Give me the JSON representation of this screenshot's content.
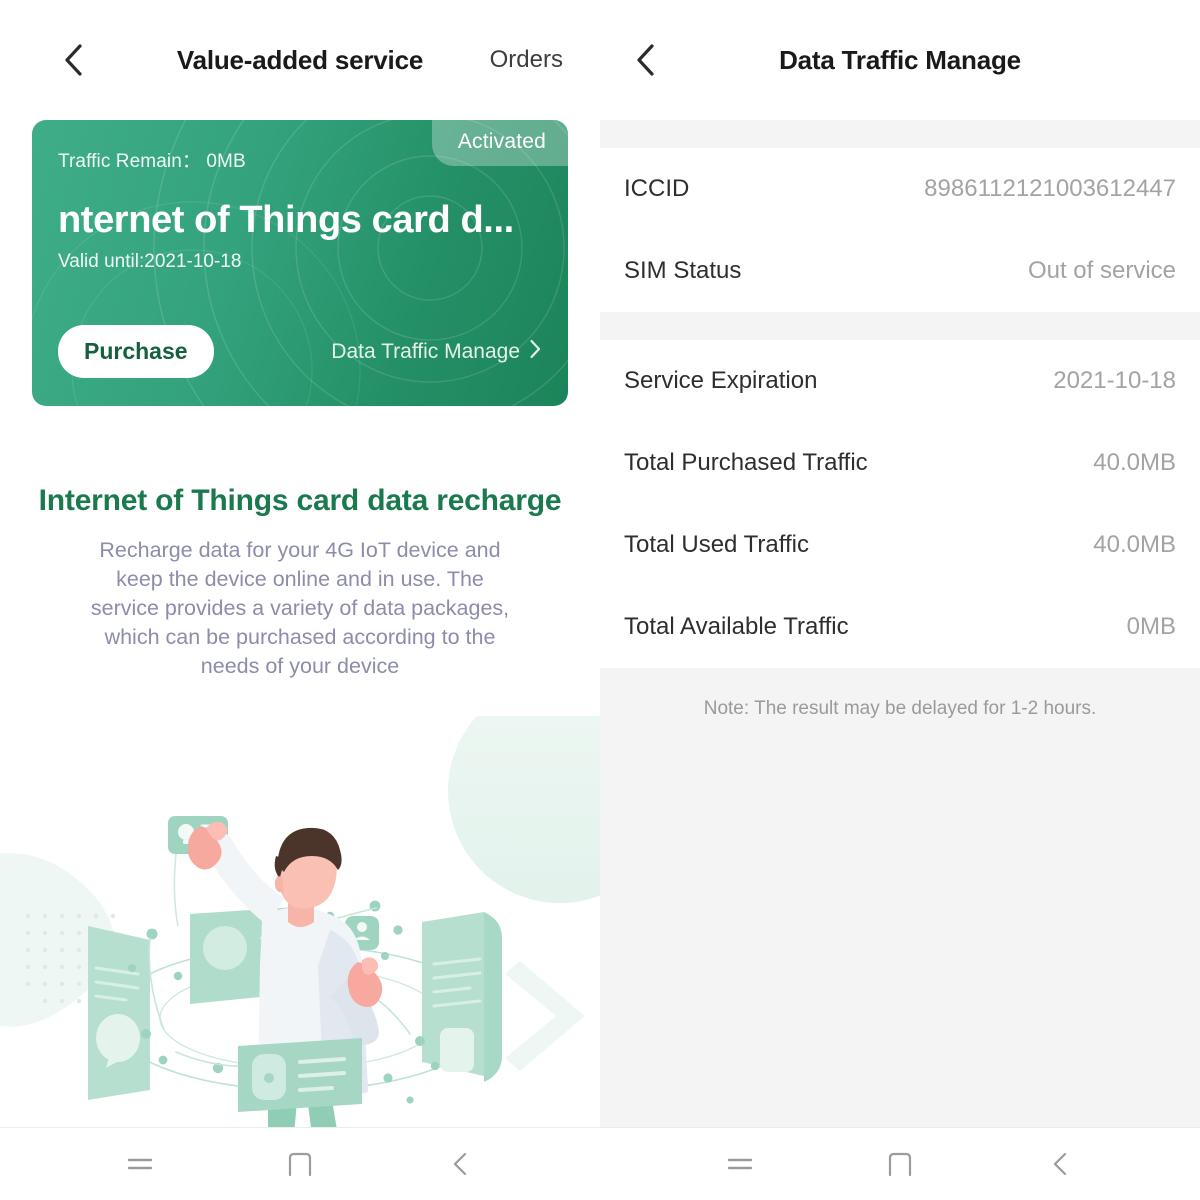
{
  "left_screen": {
    "header": {
      "back_icon": "back-chevron-icon",
      "title": "Value-added service",
      "action_label": "Orders"
    },
    "promo_card": {
      "badge": "Activated",
      "traffic_remain": "Traffic Remain： 0MB",
      "title": "nternet of Things card d...",
      "valid_until": "Valid until:2021-10-18",
      "purchase_label": "Purchase",
      "manage_label": "Data Traffic Manage",
      "manage_chevron_icon": "chevron-right-icon",
      "gradient_from": "#3fae88",
      "gradient_to": "#1c8459"
    },
    "section": {
      "heading": "Internet of Things card data recharge",
      "heading_color": "#1b7a4d",
      "description": "Recharge data for your 4G IoT device and keep the device online and in use. The service provides a variety of data packages, which can be purchased according to the needs of your device",
      "description_color": "#8c8cab"
    },
    "illustration": {
      "name": "iot-person-illustration",
      "accent": "#a8dcc8"
    }
  },
  "right_screen": {
    "header": {
      "back_icon": "back-chevron-icon",
      "title": "Data Traffic Manage"
    },
    "rows_group_1": [
      {
        "label": "ICCID",
        "value": "8986112121003612447"
      },
      {
        "label": "SIM Status",
        "value": "Out of service"
      }
    ],
    "rows_group_2": [
      {
        "label": "Service Expiration",
        "value": "2021-10-18"
      },
      {
        "label": "Total Purchased Traffic",
        "value": "40.0MB"
      },
      {
        "label": "Total Used Traffic",
        "value": "40.0MB"
      },
      {
        "label": "Total Available Traffic",
        "value": "0MB"
      }
    ],
    "note": "Note: The result may be delayed for 1-2 hours."
  },
  "system_nav": {
    "recents_icon": "recents-icon",
    "home_icon": "home-icon",
    "back_icon": "back-icon"
  }
}
